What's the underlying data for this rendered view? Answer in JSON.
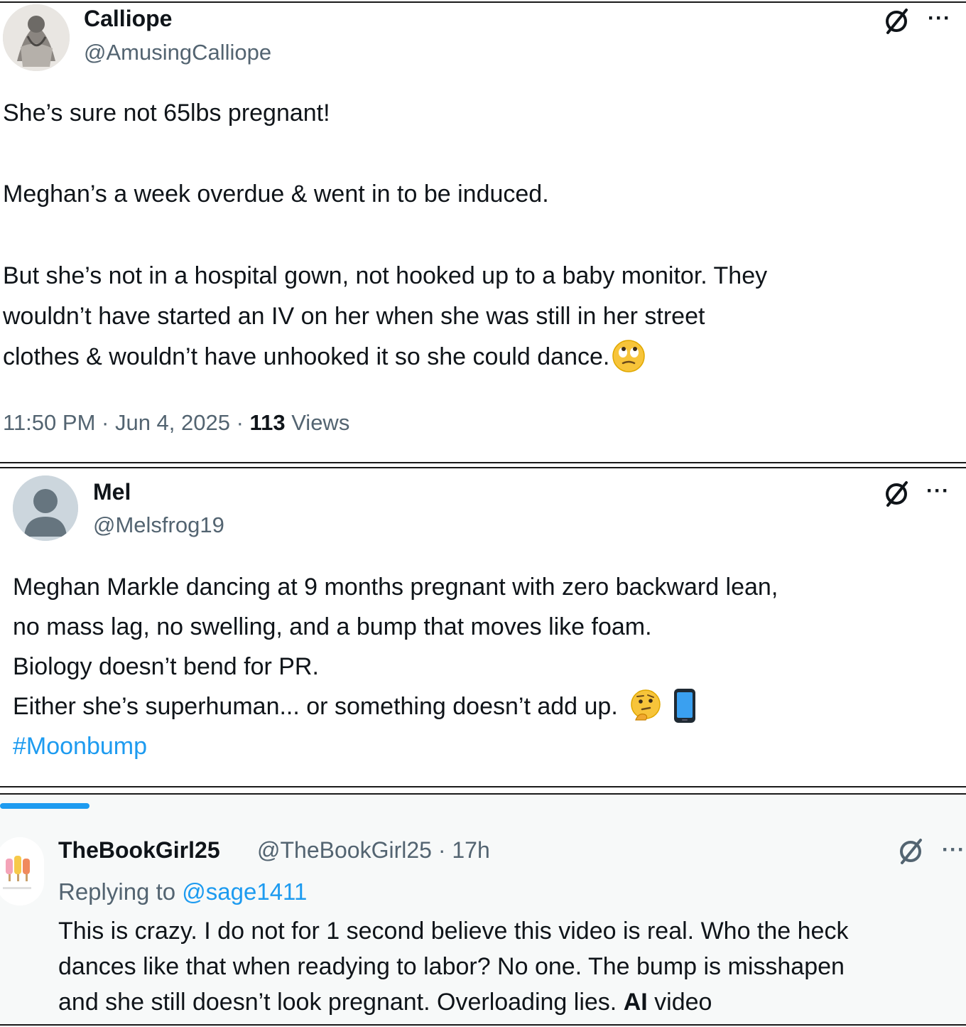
{
  "tweets": [
    {
      "name": "Calliope",
      "handle": "@AmusingCalliope",
      "para1": "She’s sure not 65lbs pregnant!",
      "para2": "Meghan’s a week overdue & went in to be induced.",
      "para3_line1": "But she’s not in a hospital gown, not hooked up to a baby monitor. They",
      "para3_line2": "wouldn’t have started an IV on her when she was still in her street",
      "para3_line3": "clothes & wouldn’t have unhooked it so she could dance.",
      "time": "11:50 PM",
      "date": "Jun 4, 2025",
      "views_count": "113",
      "views_label": "Views",
      "emoji": "face-with-rolling-eyes"
    },
    {
      "name": "Mel",
      "handle": "@Melsfrog19",
      "line1": "Meghan Markle dancing at 9 months pregnant with zero backward lean,",
      "line2": "no mass lag, no swelling, and a bump that moves like foam.",
      "line3": "Biology doesn’t bend for PR.",
      "line4": "Either she’s superhuman... or something doesn’t add up.",
      "hashtag": "#Moonbump",
      "emojis": [
        "thinking-face",
        "mobile-phone"
      ]
    },
    {
      "name": "TheBookGirl25",
      "handle": "@TheBookGirl25",
      "age": "17h",
      "replying_label": "Replying to",
      "replying_to": "@sage1411",
      "line1": "This is crazy. I do not for 1 second believe this video is real. Who the heck",
      "line2": "dances like that when readying to labor? No one. The bump is misshapen",
      "line3_a": "and she still doesn’t look pregnant. Overloading lies.",
      "line3_bold": "AI",
      "line3_b": "video"
    }
  ],
  "colors": {
    "text": "#0f1419",
    "secondary": "#536471",
    "link": "#1d9bf0",
    "reply_bg": "#f7f9f9",
    "progress": "#1d9bf0"
  },
  "icons": [
    "grok-icon",
    "more-icon",
    "avatar"
  ]
}
